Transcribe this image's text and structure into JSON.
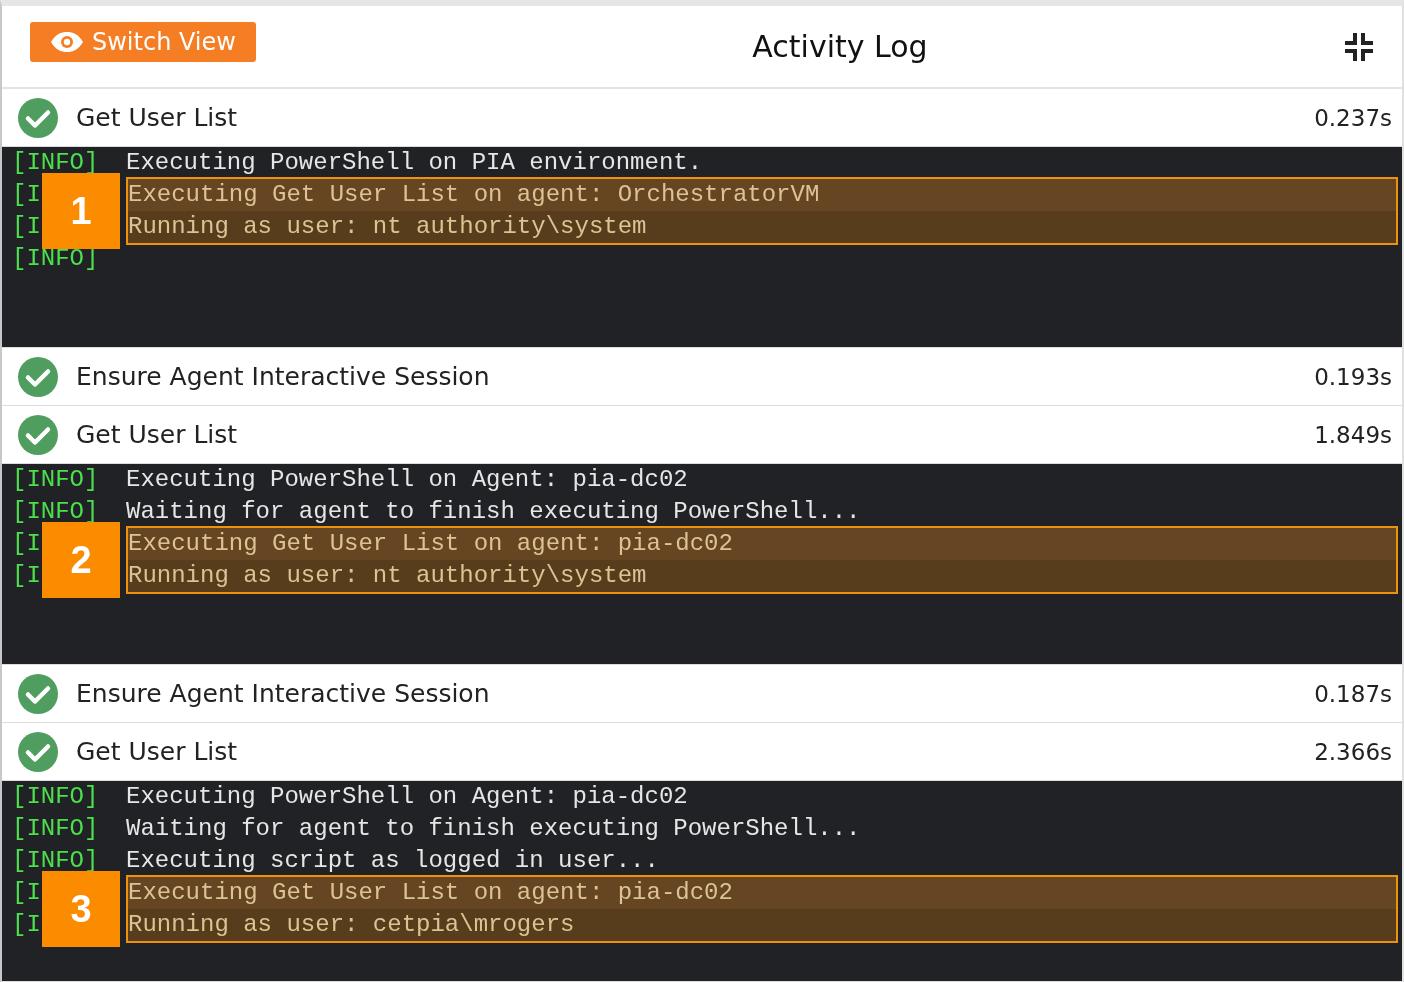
{
  "header": {
    "button": "Switch View",
    "title": "Activity Log"
  },
  "entries": [
    {
      "kind": "step",
      "name": "Get User List",
      "duration": "0.237s"
    },
    {
      "kind": "log",
      "callout": "1",
      "lines": [
        {
          "level": "[INFO]",
          "message": "Executing PowerShell on PIA environment.",
          "highlighted": false
        },
        {
          "level": "[I",
          "message": "Executing Get User List on agent: OrchestratorVM",
          "highlighted": true
        },
        {
          "level": "[I",
          "message": "Running as user: nt authority\\system",
          "highlighted": true
        },
        {
          "level": "[INFO]",
          "highlighted": false
        }
      ]
    },
    {
      "kind": "step",
      "name": "Ensure Agent Interactive Session",
      "duration": "0.193s"
    },
    {
      "kind": "step",
      "name": "Get User List",
      "duration": "1.849s"
    },
    {
      "kind": "log",
      "callout": "2",
      "lines": [
        {
          "level": "[INFO]",
          "message": "Executing PowerShell on Agent: pia-dc02",
          "highlighted": false
        },
        {
          "level": "[INFO]",
          "message": "Waiting for agent to finish executing PowerShell...",
          "highlighted": false
        },
        {
          "level": "[I",
          "message": "Executing Get User List on agent: pia-dc02",
          "highlighted": true
        },
        {
          "level": "[I",
          "message": "Running as user: nt authority\\system",
          "highlighted": true
        }
      ]
    },
    {
      "kind": "step",
      "name": "Ensure Agent Interactive Session",
      "duration": "0.187s"
    },
    {
      "kind": "step",
      "name": "Get User List",
      "duration": "2.366s"
    },
    {
      "kind": "log",
      "callout": "3",
      "lines": [
        {
          "level": "[INFO]",
          "message": "Executing PowerShell on Agent: pia-dc02",
          "highlighted": false
        },
        {
          "level": "[INFO]",
          "message": "Waiting for agent to finish executing PowerShell...",
          "highlighted": false
        },
        {
          "level": "[INFO]",
          "message": "Executing script as logged in user...",
          "highlighted": false
        },
        {
          "level": "[I",
          "message": "Executing Get User List on agent: pia-dc02",
          "highlighted": true
        },
        {
          "level": "[I",
          "message": "Running as user: cetpia\\mrogers",
          "highlighted": true
        }
      ]
    }
  ]
}
